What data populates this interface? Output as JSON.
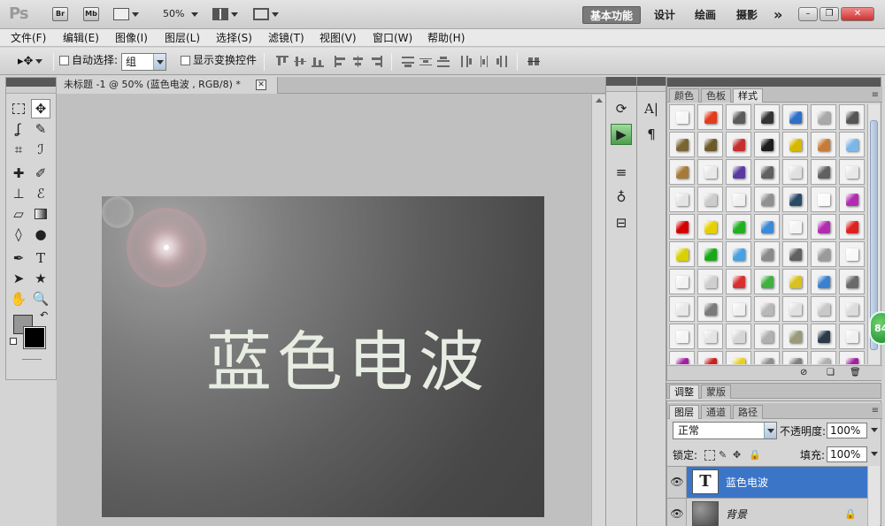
{
  "app": {
    "logo": "Ps",
    "bridge_label": "Br",
    "minibridge_label": "Mb",
    "zoom": "50%",
    "workspaces": [
      "基本功能",
      "设计",
      "绘画",
      "摄影"
    ],
    "more": "»",
    "window_buttons": [
      "–",
      "❐",
      "✕"
    ]
  },
  "menu": [
    "文件(F)",
    "编辑(E)",
    "图像(I)",
    "图层(L)",
    "选择(S)",
    "滤镜(T)",
    "视图(V)",
    "窗口(W)",
    "帮助(H)"
  ],
  "options": {
    "auto_select_label": "自动选择:",
    "auto_select_value": "组",
    "show_transform_label": "显示变换控件"
  },
  "document": {
    "tab_title": "未标题 -1 @ 50% (蓝色电波 , RGB/8) *",
    "close": "✕",
    "canvas_text": "蓝色电波"
  },
  "dock2": {
    "char_icon": "A|",
    "para_icon": "¶"
  },
  "styles_panel": {
    "tabs": [
      "颜色",
      "色板",
      "样式"
    ],
    "active_tab": "样式",
    "menu": "≡",
    "swatch_colors": [
      "#f6f6f6",
      "#e33c1c",
      "#5b5b5b",
      "#333333",
      "#2f6fc8",
      "#a9a9a9",
      "#555555",
      "#7a6433",
      "#6c5a2a",
      "#c62f2f",
      "#1d1d1d",
      "#d6b800",
      "#c87a3a",
      "#7ab6e8",
      "#a67a3a",
      "#e8e8e8",
      "#5a3aa0",
      "#606060",
      "#e0e0e0",
      "#606060",
      "#e8e8e8",
      "#e4e4e4",
      "#cccccc",
      "#f0f0f0",
      "#909090",
      "#2a4a6a",
      "#fafafa",
      "#b22cb2",
      "#d40000",
      "#e6d000",
      "#20b020",
      "#3a8ad8",
      "#f4f4f4",
      "#b22cb2",
      "#e02020",
      "#d8d000",
      "#18a818",
      "#4aa0e0",
      "#8a8a8a",
      "#606060",
      "#9a9a9a",
      "#f8f8f8",
      "#f2f2f2",
      "#cfcfcf",
      "#d83030",
      "#40b040",
      "#d8c020",
      "#3a80d0",
      "#6a6a6a",
      "#e8e8e8",
      "#7a7a7a",
      "#f0f0f0",
      "#b8b8b8",
      "#e0e0e0",
      "#c8c8c8",
      "#dcdcdc",
      "#f4f4f4",
      "#e4e4e4",
      "#d6d6d6",
      "#b0b0b0",
      "#9a9a7a",
      "#2a3a4a",
      "#f0f0f0",
      "#a020a0",
      "#c82020",
      "#e8d020",
      "#909090",
      "#808080",
      "#b0b0b0",
      "#a020a0"
    ]
  },
  "adjust_tabs": [
    "调整",
    "蒙版"
  ],
  "layers": {
    "tabs": [
      "图层",
      "通道",
      "路径"
    ],
    "blend_mode": "正常",
    "opacity_label": "不透明度:",
    "opacity": "100%",
    "lock_label": "锁定:",
    "fill_label": "填充:",
    "fill": "100%",
    "items": [
      {
        "name": "蓝色电波",
        "thumb": "T"
      },
      {
        "name": "背景",
        "thumb": ""
      }
    ]
  },
  "notification": "84"
}
